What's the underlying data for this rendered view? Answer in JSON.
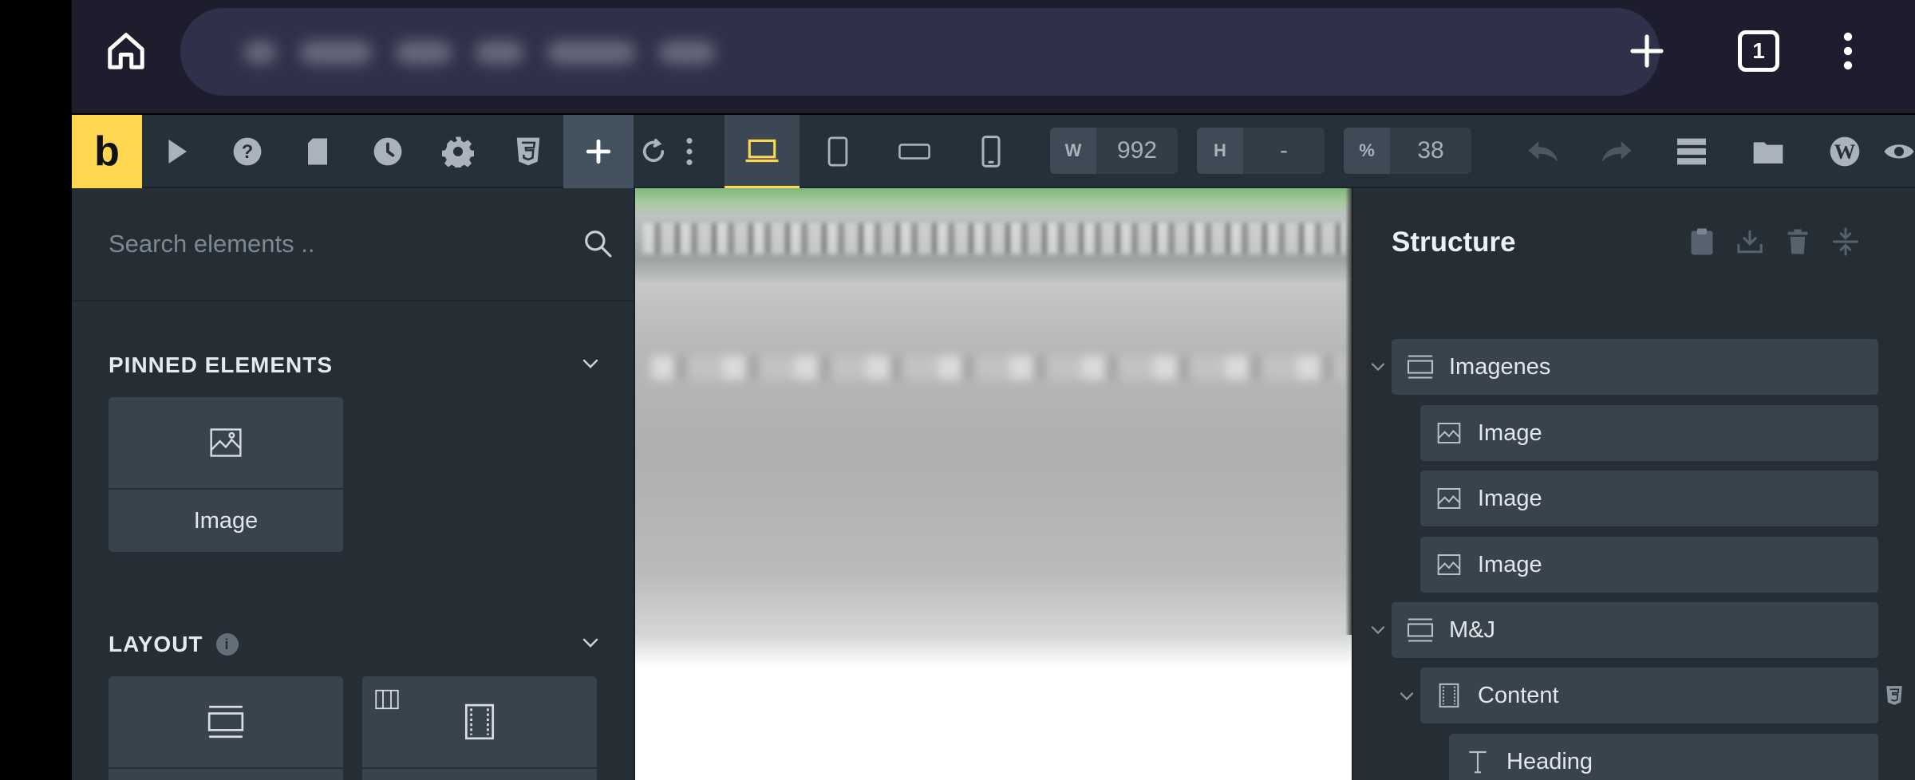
{
  "browser": {
    "url_text": "",
    "tab_count": "1"
  },
  "toolbar": {
    "logo": "b",
    "width_label": "W",
    "width_value": "992",
    "height_label": "H",
    "height_value": "-",
    "zoom_label": "%",
    "zoom_value": "38"
  },
  "left_panel": {
    "search_placeholder": "Search elements ..",
    "pinned_title": "PINNED ELEMENTS",
    "pinned_items": [
      {
        "label": "Image",
        "icon": "image-icon"
      }
    ],
    "layout_title": "LAYOUT",
    "layout_info": "i",
    "layout_items": [
      {
        "icon": "section-icon"
      },
      {
        "icon": "container-icon"
      }
    ]
  },
  "structure": {
    "title": "Structure",
    "items": [
      {
        "label": "Imagenes",
        "icon": "section-icon",
        "depth": 0,
        "expanded": true
      },
      {
        "label": "Image",
        "icon": "image-icon",
        "depth": 1
      },
      {
        "label": "Image",
        "icon": "image-icon",
        "depth": 1
      },
      {
        "label": "Image",
        "icon": "image-icon",
        "depth": 1
      },
      {
        "label": "M&J",
        "icon": "section-icon",
        "depth": 0,
        "expanded": true
      },
      {
        "label": "Content",
        "icon": "container-icon",
        "depth": 1,
        "expanded": true
      },
      {
        "label": "Heading",
        "icon": "heading-icon",
        "depth": 2
      }
    ]
  },
  "colors": {
    "accent": "#ffd64f",
    "panel_bg": "#252e35",
    "toolbar_bg": "#263038",
    "row_bg": "#38434d",
    "chrome_bg": "#1d1d2e"
  }
}
